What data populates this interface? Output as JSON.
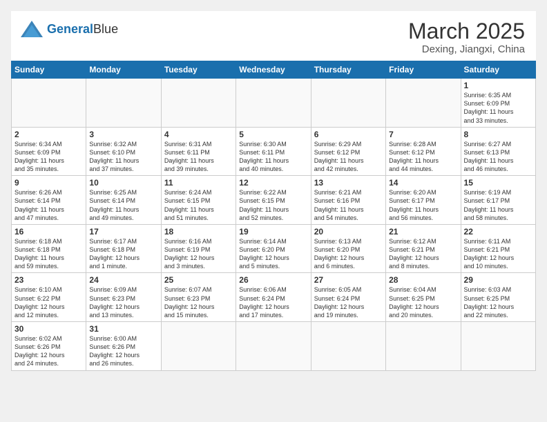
{
  "header": {
    "logo_general": "General",
    "logo_blue": "Blue",
    "month_year": "March 2025",
    "location": "Dexing, Jiangxi, China"
  },
  "weekdays": [
    "Sunday",
    "Monday",
    "Tuesday",
    "Wednesday",
    "Thursday",
    "Friday",
    "Saturday"
  ],
  "weeks": [
    [
      {
        "day": "",
        "info": ""
      },
      {
        "day": "",
        "info": ""
      },
      {
        "day": "",
        "info": ""
      },
      {
        "day": "",
        "info": ""
      },
      {
        "day": "",
        "info": ""
      },
      {
        "day": "",
        "info": ""
      },
      {
        "day": "1",
        "info": "Sunrise: 6:35 AM\nSunset: 6:09 PM\nDaylight: 11 hours\nand 33 minutes."
      }
    ],
    [
      {
        "day": "2",
        "info": "Sunrise: 6:34 AM\nSunset: 6:09 PM\nDaylight: 11 hours\nand 35 minutes."
      },
      {
        "day": "3",
        "info": "Sunrise: 6:32 AM\nSunset: 6:10 PM\nDaylight: 11 hours\nand 37 minutes."
      },
      {
        "day": "4",
        "info": "Sunrise: 6:31 AM\nSunset: 6:11 PM\nDaylight: 11 hours\nand 39 minutes."
      },
      {
        "day": "5",
        "info": "Sunrise: 6:30 AM\nSunset: 6:11 PM\nDaylight: 11 hours\nand 40 minutes."
      },
      {
        "day": "6",
        "info": "Sunrise: 6:29 AM\nSunset: 6:12 PM\nDaylight: 11 hours\nand 42 minutes."
      },
      {
        "day": "7",
        "info": "Sunrise: 6:28 AM\nSunset: 6:12 PM\nDaylight: 11 hours\nand 44 minutes."
      },
      {
        "day": "8",
        "info": "Sunrise: 6:27 AM\nSunset: 6:13 PM\nDaylight: 11 hours\nand 46 minutes."
      }
    ],
    [
      {
        "day": "9",
        "info": "Sunrise: 6:26 AM\nSunset: 6:14 PM\nDaylight: 11 hours\nand 47 minutes."
      },
      {
        "day": "10",
        "info": "Sunrise: 6:25 AM\nSunset: 6:14 PM\nDaylight: 11 hours\nand 49 minutes."
      },
      {
        "day": "11",
        "info": "Sunrise: 6:24 AM\nSunset: 6:15 PM\nDaylight: 11 hours\nand 51 minutes."
      },
      {
        "day": "12",
        "info": "Sunrise: 6:22 AM\nSunset: 6:15 PM\nDaylight: 11 hours\nand 52 minutes."
      },
      {
        "day": "13",
        "info": "Sunrise: 6:21 AM\nSunset: 6:16 PM\nDaylight: 11 hours\nand 54 minutes."
      },
      {
        "day": "14",
        "info": "Sunrise: 6:20 AM\nSunset: 6:17 PM\nDaylight: 11 hours\nand 56 minutes."
      },
      {
        "day": "15",
        "info": "Sunrise: 6:19 AM\nSunset: 6:17 PM\nDaylight: 11 hours\nand 58 minutes."
      }
    ],
    [
      {
        "day": "16",
        "info": "Sunrise: 6:18 AM\nSunset: 6:18 PM\nDaylight: 11 hours\nand 59 minutes."
      },
      {
        "day": "17",
        "info": "Sunrise: 6:17 AM\nSunset: 6:18 PM\nDaylight: 12 hours\nand 1 minute."
      },
      {
        "day": "18",
        "info": "Sunrise: 6:16 AM\nSunset: 6:19 PM\nDaylight: 12 hours\nand 3 minutes."
      },
      {
        "day": "19",
        "info": "Sunrise: 6:14 AM\nSunset: 6:20 PM\nDaylight: 12 hours\nand 5 minutes."
      },
      {
        "day": "20",
        "info": "Sunrise: 6:13 AM\nSunset: 6:20 PM\nDaylight: 12 hours\nand 6 minutes."
      },
      {
        "day": "21",
        "info": "Sunrise: 6:12 AM\nSunset: 6:21 PM\nDaylight: 12 hours\nand 8 minutes."
      },
      {
        "day": "22",
        "info": "Sunrise: 6:11 AM\nSunset: 6:21 PM\nDaylight: 12 hours\nand 10 minutes."
      }
    ],
    [
      {
        "day": "23",
        "info": "Sunrise: 6:10 AM\nSunset: 6:22 PM\nDaylight: 12 hours\nand 12 minutes."
      },
      {
        "day": "24",
        "info": "Sunrise: 6:09 AM\nSunset: 6:23 PM\nDaylight: 12 hours\nand 13 minutes."
      },
      {
        "day": "25",
        "info": "Sunrise: 6:07 AM\nSunset: 6:23 PM\nDaylight: 12 hours\nand 15 minutes."
      },
      {
        "day": "26",
        "info": "Sunrise: 6:06 AM\nSunset: 6:24 PM\nDaylight: 12 hours\nand 17 minutes."
      },
      {
        "day": "27",
        "info": "Sunrise: 6:05 AM\nSunset: 6:24 PM\nDaylight: 12 hours\nand 19 minutes."
      },
      {
        "day": "28",
        "info": "Sunrise: 6:04 AM\nSunset: 6:25 PM\nDaylight: 12 hours\nand 20 minutes."
      },
      {
        "day": "29",
        "info": "Sunrise: 6:03 AM\nSunset: 6:25 PM\nDaylight: 12 hours\nand 22 minutes."
      }
    ],
    [
      {
        "day": "30",
        "info": "Sunrise: 6:02 AM\nSunset: 6:26 PM\nDaylight: 12 hours\nand 24 minutes."
      },
      {
        "day": "31",
        "info": "Sunrise: 6:00 AM\nSunset: 6:26 PM\nDaylight: 12 hours\nand 26 minutes."
      },
      {
        "day": "",
        "info": ""
      },
      {
        "day": "",
        "info": ""
      },
      {
        "day": "",
        "info": ""
      },
      {
        "day": "",
        "info": ""
      },
      {
        "day": "",
        "info": ""
      }
    ]
  ]
}
